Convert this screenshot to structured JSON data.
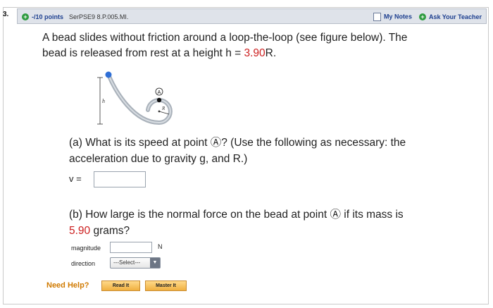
{
  "question": {
    "number": "3.",
    "points": "-/10 points",
    "reference": "SerPSE9 8.P.005.MI.",
    "my_notes": "My Notes",
    "ask_teacher": "Ask Your Teacher",
    "intro_line1": "A bead slides without friction around a loop-the-loop (see figure below). The",
    "intro_line2_pre": "bead is released from rest at a height h = ",
    "intro_value": "3.90",
    "intro_line2_post": "R.",
    "figure": {
      "label_h": "h",
      "label_R": "R",
      "label_A": "A"
    },
    "part_a_line1": "(a) What is its speed at point Ⓐ? (Use the following as necessary: the",
    "part_a_line2": "acceleration due to gravity g, and R.)",
    "v_label": "v =",
    "part_b_line1": "(b) How large is the normal force on the bead at point Ⓐ if its mass is",
    "part_b_mass": "5.90",
    "part_b_line2_post": " grams?",
    "magnitude_label": "magnitude",
    "magnitude_unit": "N",
    "direction_label": "direction",
    "direction_select": "---Select---",
    "need_help": "Need Help?",
    "read_it": "Read It",
    "master_it": "Master It"
  }
}
